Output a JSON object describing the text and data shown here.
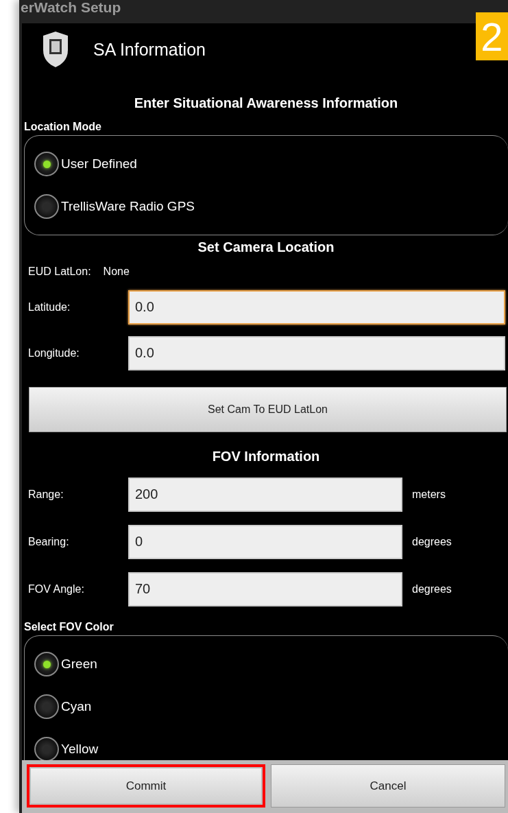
{
  "background": {
    "title": "erWatch Setup"
  },
  "dialog": {
    "title": "SA Information",
    "heading": "Enter Situational Awareness Information",
    "location_mode": {
      "label": "Location Mode",
      "options": [
        {
          "label": "User Defined",
          "selected": true
        },
        {
          "label": "TrellisWare Radio GPS",
          "selected": false
        }
      ]
    },
    "camera_location": {
      "heading": "Set Camera Location",
      "eud_label": "EUD LatLon:",
      "eud_value": "None",
      "fields": [
        {
          "label": "Latitude:",
          "value": "0.0",
          "focused": true
        },
        {
          "label": "Longitude:",
          "value": "0.0",
          "focused": false
        }
      ],
      "button": "Set Cam To EUD LatLon"
    },
    "fov": {
      "heading": "FOV Information",
      "fields": [
        {
          "label": "Range:",
          "value": "200",
          "unit": "meters"
        },
        {
          "label": "Bearing:",
          "value": "0",
          "unit": "degrees"
        },
        {
          "label": "FOV Angle:",
          "value": "70",
          "unit": "degrees"
        }
      ]
    },
    "fov_color": {
      "label": "Select FOV Color",
      "options": [
        {
          "label": "Green",
          "selected": true
        },
        {
          "label": "Cyan",
          "selected": false
        },
        {
          "label": "Yellow",
          "selected": false
        }
      ]
    },
    "buttons": [
      {
        "label": "Commit",
        "highlighted": true
      },
      {
        "label": "Cancel",
        "highlighted": false
      }
    ]
  },
  "step_badge": "2"
}
